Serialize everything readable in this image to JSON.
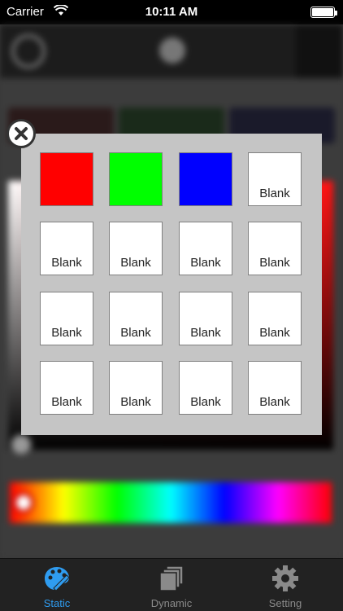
{
  "status_bar": {
    "carrier": "Carrier",
    "time": "10:11 AM"
  },
  "colors": {
    "accent": "#2f9cf0",
    "tab_inactive": "#8a8a8a",
    "modal_bg": "#c5c5c5"
  },
  "background": {
    "preset_tiles": [
      "#2a1a1a",
      "#1a2a1a",
      "#1a1a2a"
    ]
  },
  "swatch_picker": {
    "close_icon": "close-icon",
    "rows": [
      [
        {
          "label": "",
          "color": "#ff0000"
        },
        {
          "label": "",
          "color": "#00ff00"
        },
        {
          "label": "",
          "color": "#0000ff"
        },
        {
          "label": "Blank",
          "color": "#ffffff"
        }
      ],
      [
        {
          "label": "Blank",
          "color": "#ffffff"
        },
        {
          "label": "Blank",
          "color": "#ffffff"
        },
        {
          "label": "Blank",
          "color": "#ffffff"
        },
        {
          "label": "Blank",
          "color": "#ffffff"
        }
      ],
      [
        {
          "label": "Blank",
          "color": "#ffffff"
        },
        {
          "label": "Blank",
          "color": "#ffffff"
        },
        {
          "label": "Blank",
          "color": "#ffffff"
        },
        {
          "label": "Blank",
          "color": "#ffffff"
        }
      ],
      [
        {
          "label": "Blank",
          "color": "#ffffff"
        },
        {
          "label": "Blank",
          "color": "#ffffff"
        },
        {
          "label": "Blank",
          "color": "#ffffff"
        },
        {
          "label": "Blank",
          "color": "#ffffff"
        }
      ]
    ]
  },
  "tab_bar": {
    "tabs": [
      {
        "label": "Static",
        "icon": "palette-icon",
        "active": true
      },
      {
        "label": "Dynamic",
        "icon": "stacked-pages-icon",
        "active": false
      },
      {
        "label": "Setting",
        "icon": "gear-icon",
        "active": false
      }
    ]
  }
}
